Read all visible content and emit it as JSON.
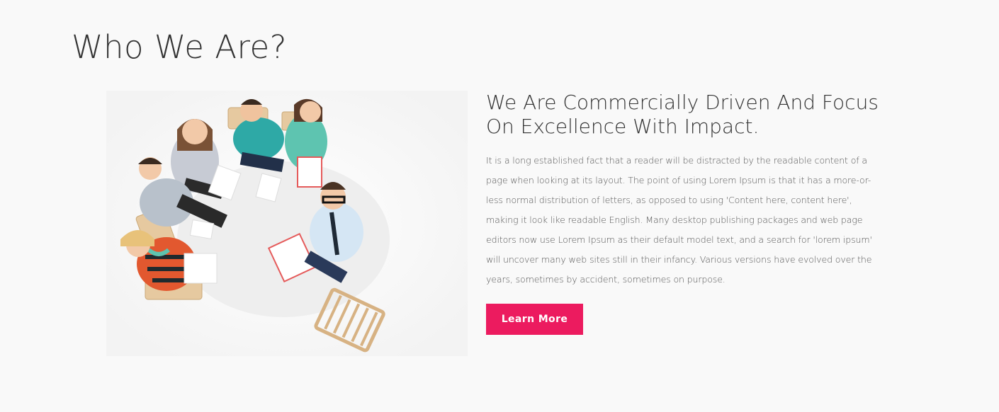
{
  "section": {
    "title": "Who We Are?"
  },
  "about": {
    "headline_line1": "We Are Commercially Driven And Focus",
    "headline_line2": "On Excellence With Impact.",
    "body": "It is a long established fact that a reader will be distracted by the readable content of a page when looking at its layout. The point of using Lorem Ipsum is that it has a more-or-less normal distribution of letters, as opposed to using 'Content here, content here', making it look like readable English. Many desktop publishing packages and web page editors now use Lorem Ipsum as their default model text, and a search for 'lorem ipsum' will uncover many web sites still in their infancy. Various versions have evolved over the years, sometimes by accident, sometimes on purpose.",
    "cta_label": "Learn More"
  },
  "colors": {
    "accent": "#ec1b5f",
    "background": "#f9f9f9",
    "heading": "#333333",
    "text": "#555555"
  },
  "image": {
    "subject": "team-photo"
  }
}
